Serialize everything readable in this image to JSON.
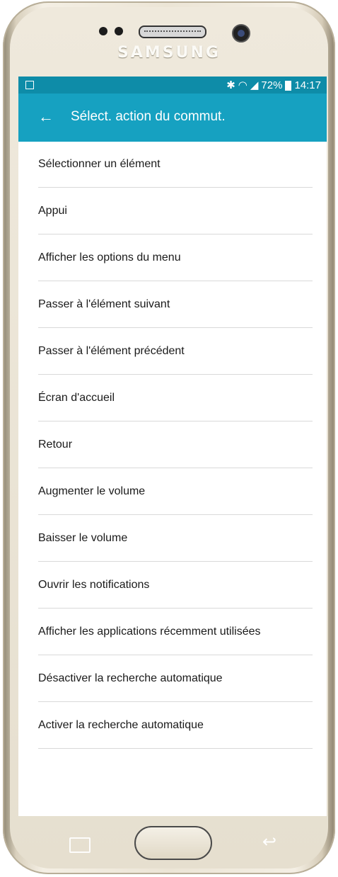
{
  "device": {
    "brand": "SAMSUNG"
  },
  "status_bar": {
    "battery": "72%",
    "time": "14:17",
    "icons": [
      "bluetooth-icon",
      "wifi-icon",
      "signal-icon",
      "battery-icon"
    ]
  },
  "app_bar": {
    "title": "Sélect. action du commut.",
    "back_icon": "arrow-left-icon"
  },
  "actions": [
    "Sélectionner un élément",
    "Appui",
    "Afficher les options du menu",
    "Passer à l'élément suivant",
    "Passer à l'élément précédent",
    "Écran d'accueil",
    "Retour",
    "Augmenter le volume",
    "Baisser le volume",
    "Ouvrir les notifications",
    "Afficher les applications récemment utilisées",
    "Désactiver la recherche automatique",
    "Activer la recherche automatique"
  ],
  "colors": {
    "app_bar": "#16a1c1",
    "status_bar": "#0e8ca8",
    "phone_body": "#ece5d6"
  }
}
